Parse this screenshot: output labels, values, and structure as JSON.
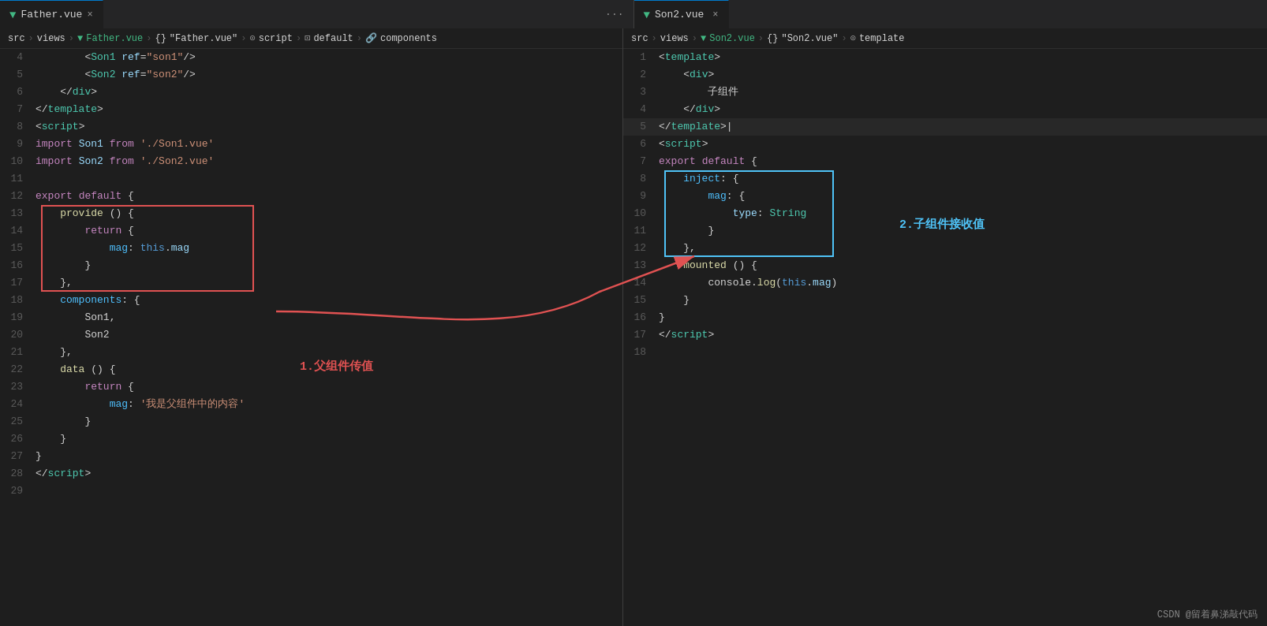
{
  "left_tab": {
    "vue_icon": "▼",
    "filename": "Father.vue",
    "close": "×"
  },
  "right_tab": {
    "vue_icon": "▼",
    "filename": "Son2.vue",
    "close": "×"
  },
  "more_icon": "···",
  "left_breadcrumb": {
    "items": [
      "src",
      ">",
      "views",
      ">",
      "Father.vue",
      ">",
      "{}",
      "\"Father.vue\"",
      ">",
      "script",
      ">",
      "default",
      ">",
      "components"
    ]
  },
  "right_breadcrumb": {
    "items": [
      "src",
      ">",
      "views",
      ">",
      "Son2.vue",
      ">",
      "{}",
      "\"Son2.vue\"",
      ">",
      "template"
    ]
  },
  "annotation1": "1.父组件传值",
  "annotation2": "2.子组件接收值",
  "watermark": "CSDN @留着鼻涕敲代码",
  "left_lines": [
    {
      "num": "4",
      "tokens": [
        {
          "t": "        ",
          "c": ""
        },
        {
          "t": "<",
          "c": "c-white"
        },
        {
          "t": "Son1",
          "c": "c-tag"
        },
        {
          "t": " ",
          "c": ""
        },
        {
          "t": "ref",
          "c": "c-attr"
        },
        {
          "t": "=",
          "c": "c-white"
        },
        {
          "t": "\"son1\"",
          "c": "c-val"
        },
        {
          "t": "/>",
          "c": "c-white"
        }
      ]
    },
    {
      "num": "5",
      "tokens": [
        {
          "t": "        ",
          "c": ""
        },
        {
          "t": "<",
          "c": "c-white"
        },
        {
          "t": "Son2",
          "c": "c-tag"
        },
        {
          "t": " ",
          "c": ""
        },
        {
          "t": "ref",
          "c": "c-attr"
        },
        {
          "t": "=",
          "c": "c-white"
        },
        {
          "t": "\"son2\"",
          "c": "c-val"
        },
        {
          "t": "/>",
          "c": "c-white"
        }
      ]
    },
    {
      "num": "6",
      "tokens": [
        {
          "t": "    ",
          "c": ""
        },
        {
          "t": "</",
          "c": "c-white"
        },
        {
          "t": "div",
          "c": "c-tag"
        },
        {
          "t": ">",
          "c": "c-white"
        }
      ]
    },
    {
      "num": "7",
      "tokens": [
        {
          "t": "",
          "c": ""
        },
        {
          "t": "</",
          "c": "c-white"
        },
        {
          "t": "template",
          "c": "c-tag"
        },
        {
          "t": ">",
          "c": "c-white"
        }
      ]
    },
    {
      "num": "8",
      "tokens": [
        {
          "t": "",
          "c": ""
        },
        {
          "t": "<",
          "c": "c-white"
        },
        {
          "t": "script",
          "c": "c-tag"
        },
        {
          "t": ">",
          "c": "c-white"
        }
      ]
    },
    {
      "num": "9",
      "tokens": [
        {
          "t": "",
          "c": ""
        },
        {
          "t": "import",
          "c": "c-import"
        },
        {
          "t": " ",
          "c": ""
        },
        {
          "t": "Son1",
          "c": "c-varname"
        },
        {
          "t": " ",
          "c": ""
        },
        {
          "t": "from",
          "c": "c-from"
        },
        {
          "t": " ",
          "c": ""
        },
        {
          "t": "'./Son1.vue'",
          "c": "c-string"
        }
      ]
    },
    {
      "num": "10",
      "tokens": [
        {
          "t": "",
          "c": ""
        },
        {
          "t": "import",
          "c": "c-import"
        },
        {
          "t": " ",
          "c": ""
        },
        {
          "t": "Son2",
          "c": "c-varname"
        },
        {
          "t": " ",
          "c": ""
        },
        {
          "t": "from",
          "c": "c-from"
        },
        {
          "t": " ",
          "c": ""
        },
        {
          "t": "'./Son2.vue'",
          "c": "c-string"
        }
      ]
    },
    {
      "num": "11",
      "tokens": [
        {
          "t": "",
          "c": ""
        }
      ]
    },
    {
      "num": "12",
      "tokens": [
        {
          "t": "",
          "c": ""
        },
        {
          "t": "export",
          "c": "c-keyword"
        },
        {
          "t": " ",
          "c": ""
        },
        {
          "t": "default",
          "c": "c-keyword"
        },
        {
          "t": " ",
          "c": ""
        },
        {
          "t": "{",
          "c": "c-white"
        }
      ]
    },
    {
      "num": "13",
      "tokens": [
        {
          "t": "    ",
          "c": ""
        },
        {
          "t": "provide",
          "c": "c-yellow"
        },
        {
          "t": " ",
          "c": ""
        },
        {
          "t": "()",
          "c": "c-white"
        },
        {
          "t": " ",
          "c": ""
        },
        {
          "t": "{",
          "c": "c-white"
        }
      ],
      "boxed_red": true
    },
    {
      "num": "14",
      "tokens": [
        {
          "t": "        ",
          "c": ""
        },
        {
          "t": "return",
          "c": "c-keyword"
        },
        {
          "t": " ",
          "c": ""
        },
        {
          "t": "{",
          "c": "c-white"
        }
      ],
      "boxed_red": true
    },
    {
      "num": "15",
      "tokens": [
        {
          "t": "            ",
          "c": ""
        },
        {
          "t": "mag",
          "c": "c-cyan"
        },
        {
          "t": ":",
          "c": "c-white"
        },
        {
          "t": " ",
          "c": ""
        },
        {
          "t": "this",
          "c": "c-keyword2"
        },
        {
          "t": ".",
          "c": "c-white"
        },
        {
          "t": "mag",
          "c": "c-prop"
        }
      ],
      "boxed_red": true
    },
    {
      "num": "16",
      "tokens": [
        {
          "t": "        ",
          "c": ""
        },
        {
          "t": "}",
          "c": "c-white"
        }
      ],
      "boxed_red": true
    },
    {
      "num": "17",
      "tokens": [
        {
          "t": "    ",
          "c": ""
        },
        {
          "t": "},",
          "c": "c-white"
        }
      ],
      "boxed_red": true
    },
    {
      "num": "18",
      "tokens": [
        {
          "t": "    ",
          "c": ""
        },
        {
          "t": "components",
          "c": "c-cyan"
        },
        {
          "t": ": ",
          "c": "c-white"
        },
        {
          "t": "{",
          "c": "c-white"
        }
      ]
    },
    {
      "num": "19",
      "tokens": [
        {
          "t": "        ",
          "c": ""
        },
        {
          "t": "Son1",
          "c": "c-white"
        },
        {
          "t": ",",
          "c": "c-white"
        }
      ]
    },
    {
      "num": "20",
      "tokens": [
        {
          "t": "        ",
          "c": ""
        },
        {
          "t": "Son2",
          "c": "c-white"
        }
      ]
    },
    {
      "num": "21",
      "tokens": [
        {
          "t": "    ",
          "c": ""
        },
        {
          "t": "},",
          "c": "c-white"
        }
      ]
    },
    {
      "num": "22",
      "tokens": [
        {
          "t": "    ",
          "c": ""
        },
        {
          "t": "data",
          "c": "c-yellow"
        },
        {
          "t": " ",
          "c": ""
        },
        {
          "t": "()",
          "c": "c-white"
        },
        {
          "t": " ",
          "c": ""
        },
        {
          "t": "{",
          "c": "c-white"
        }
      ]
    },
    {
      "num": "23",
      "tokens": [
        {
          "t": "        ",
          "c": ""
        },
        {
          "t": "return",
          "c": "c-keyword"
        },
        {
          "t": " ",
          "c": ""
        },
        {
          "t": "{",
          "c": "c-white"
        }
      ]
    },
    {
      "num": "24",
      "tokens": [
        {
          "t": "            ",
          "c": ""
        },
        {
          "t": "mag",
          "c": "c-cyan"
        },
        {
          "t": ": ",
          "c": "c-white"
        },
        {
          "t": "'我是父组件中的内容'",
          "c": "c-string"
        }
      ]
    },
    {
      "num": "25",
      "tokens": [
        {
          "t": "        ",
          "c": ""
        },
        {
          "t": "}",
          "c": "c-white"
        }
      ]
    },
    {
      "num": "26",
      "tokens": [
        {
          "t": "    ",
          "c": ""
        },
        {
          "t": "}",
          "c": "c-white"
        }
      ]
    },
    {
      "num": "27",
      "tokens": [
        {
          "t": "",
          "c": ""
        },
        {
          "t": "}",
          "c": "c-white"
        }
      ]
    },
    {
      "num": "28",
      "tokens": [
        {
          "t": "",
          "c": ""
        },
        {
          "t": "</",
          "c": "c-white"
        },
        {
          "t": "script",
          "c": "c-tag"
        },
        {
          "t": ">",
          "c": "c-white"
        }
      ]
    },
    {
      "num": "29",
      "tokens": [
        {
          "t": "",
          "c": ""
        }
      ]
    }
  ],
  "right_lines": [
    {
      "num": "1",
      "tokens": [
        {
          "t": "",
          "c": ""
        },
        {
          "t": "<",
          "c": "c-white"
        },
        {
          "t": "template",
          "c": "c-tag"
        },
        {
          "t": ">",
          "c": "c-white"
        }
      ]
    },
    {
      "num": "2",
      "tokens": [
        {
          "t": "    ",
          "c": ""
        },
        {
          "t": "<",
          "c": "c-white"
        },
        {
          "t": "div",
          "c": "c-tag"
        },
        {
          "t": ">",
          "c": "c-white"
        }
      ]
    },
    {
      "num": "3",
      "tokens": [
        {
          "t": "        ",
          "c": ""
        },
        {
          "t": "子组件",
          "c": "c-white"
        }
      ]
    },
    {
      "num": "4",
      "tokens": [
        {
          "t": "    ",
          "c": ""
        },
        {
          "t": "</",
          "c": "c-white"
        },
        {
          "t": "div",
          "c": "c-tag"
        },
        {
          "t": ">",
          "c": "c-white"
        }
      ]
    },
    {
      "num": "5",
      "tokens": [
        {
          "t": "",
          "c": ""
        },
        {
          "t": "</",
          "c": "c-white"
        },
        {
          "t": "template",
          "c": "c-tag"
        },
        {
          "t": ">",
          "c": "c-white"
        },
        {
          "t": "|",
          "c": "c-white"
        }
      ],
      "active": true
    },
    {
      "num": "6",
      "tokens": [
        {
          "t": "",
          "c": ""
        },
        {
          "t": "<",
          "c": "c-white"
        },
        {
          "t": "script",
          "c": "c-tag"
        },
        {
          "t": ">",
          "c": "c-white"
        }
      ]
    },
    {
      "num": "7",
      "tokens": [
        {
          "t": "",
          "c": ""
        },
        {
          "t": "export",
          "c": "c-keyword"
        },
        {
          "t": " ",
          "c": ""
        },
        {
          "t": "default",
          "c": "c-keyword"
        },
        {
          "t": " ",
          "c": ""
        },
        {
          "t": "{",
          "c": "c-white"
        }
      ]
    },
    {
      "num": "8",
      "tokens": [
        {
          "t": "    ",
          "c": ""
        },
        {
          "t": "inject",
          "c": "c-cyan"
        },
        {
          "t": ": ",
          "c": "c-white"
        },
        {
          "t": "{",
          "c": "c-white"
        }
      ],
      "boxed_blue": true
    },
    {
      "num": "9",
      "tokens": [
        {
          "t": "        ",
          "c": ""
        },
        {
          "t": "mag",
          "c": "c-cyan"
        },
        {
          "t": ": ",
          "c": "c-white"
        },
        {
          "t": "{",
          "c": "c-white"
        }
      ],
      "boxed_blue": true
    },
    {
      "num": "10",
      "tokens": [
        {
          "t": "            ",
          "c": ""
        },
        {
          "t": "type",
          "c": "c-prop"
        },
        {
          "t": ": ",
          "c": "c-white"
        },
        {
          "t": "String",
          "c": "c-type"
        }
      ],
      "boxed_blue": true
    },
    {
      "num": "11",
      "tokens": [
        {
          "t": "        ",
          "c": ""
        },
        {
          "t": "}",
          "c": "c-white"
        }
      ],
      "boxed_blue": true
    },
    {
      "num": "12",
      "tokens": [
        {
          "t": "    ",
          "c": ""
        },
        {
          "t": "},",
          "c": "c-white"
        }
      ],
      "boxed_blue": true
    },
    {
      "num": "13",
      "tokens": [
        {
          "t": "    ",
          "c": ""
        },
        {
          "t": "mounted",
          "c": "c-yellow"
        },
        {
          "t": " ",
          "c": ""
        },
        {
          "t": "()",
          "c": "c-white"
        },
        {
          "t": " ",
          "c": ""
        },
        {
          "t": "{",
          "c": "c-white"
        }
      ]
    },
    {
      "num": "14",
      "tokens": [
        {
          "t": "        ",
          "c": ""
        },
        {
          "t": "console",
          "c": "c-white"
        },
        {
          "t": ".",
          "c": "c-white"
        },
        {
          "t": "log",
          "c": "c-yellow"
        },
        {
          "t": "(",
          "c": "c-white"
        },
        {
          "t": "this",
          "c": "c-keyword2"
        },
        {
          "t": ".",
          "c": "c-white"
        },
        {
          "t": "mag",
          "c": "c-prop"
        },
        {
          "t": ")",
          "c": "c-white"
        }
      ]
    },
    {
      "num": "15",
      "tokens": [
        {
          "t": "    ",
          "c": ""
        },
        {
          "t": "}",
          "c": "c-white"
        }
      ]
    },
    {
      "num": "16",
      "tokens": [
        {
          "t": "",
          "c": ""
        },
        {
          "t": "}",
          "c": "c-white"
        }
      ]
    },
    {
      "num": "17",
      "tokens": [
        {
          "t": "",
          "c": ""
        },
        {
          "t": "</",
          "c": "c-white"
        },
        {
          "t": "script",
          "c": "c-tag"
        },
        {
          "t": ">",
          "c": "c-white"
        }
      ]
    },
    {
      "num": "18",
      "tokens": [
        {
          "t": "",
          "c": ""
        }
      ]
    }
  ]
}
